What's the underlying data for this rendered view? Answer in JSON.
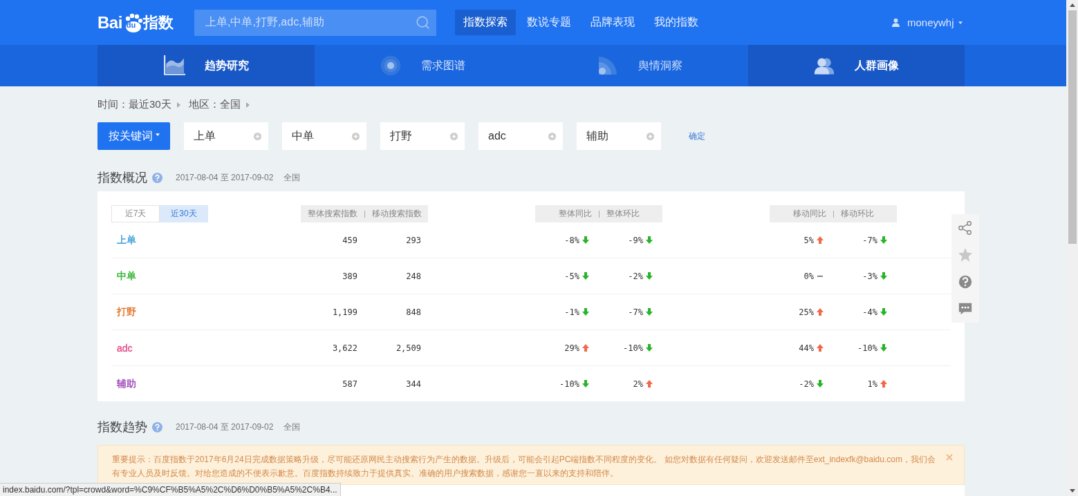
{
  "header": {
    "logo": {
      "left": "Bai",
      "paw": "du",
      "right": "指数"
    },
    "search": {
      "value": "上单,中单,打野,adc,辅助"
    },
    "nav": [
      {
        "label": "指数探索",
        "selected": true
      },
      {
        "label": "数说专题",
        "selected": false
      },
      {
        "label": "品牌表现",
        "selected": false
      },
      {
        "label": "我的指数",
        "selected": false
      }
    ],
    "user": {
      "name": "moneywhj"
    }
  },
  "subnav": [
    {
      "label": "趋势研究",
      "selected": true,
      "kind": "area"
    },
    {
      "label": "需求图谱",
      "selected": false,
      "kind": "ring"
    },
    {
      "label": "舆情洞察",
      "selected": false,
      "kind": "wave"
    },
    {
      "label": "人群画像",
      "selected": true,
      "kind": "people"
    }
  ],
  "filters": [
    "时间：最近30天",
    "地区：全国"
  ],
  "keywords": {
    "mode": "按关键词",
    "items": [
      "上单",
      "中单",
      "打野",
      "adc",
      "辅助"
    ],
    "confirm": "确定"
  },
  "overview": {
    "title": "指数概况",
    "dates": "2017-08-04 至 2017-09-02",
    "region": "全国",
    "ranges": [
      {
        "label": "近7天",
        "selected": false
      },
      {
        "label": "近30天",
        "selected": true
      }
    ],
    "groups": [
      [
        "整体搜索指数",
        "移动搜索指数"
      ],
      [
        "整体同比",
        "整体环比"
      ],
      [
        "移动同比",
        "移动环比"
      ]
    ],
    "rows": [
      {
        "keyword": "上单",
        "color": "#3a9fd8",
        "total": "459",
        "mobile": "293",
        "changes": [
          {
            "value": "-8%",
            "kind": "down"
          },
          {
            "value": "-9%",
            "kind": "down"
          },
          {
            "value": "5%",
            "kind": "up"
          },
          {
            "value": "-7%",
            "kind": "down"
          }
        ]
      },
      {
        "keyword": "中单",
        "color": "#2fb02f",
        "total": "389",
        "mobile": "248",
        "changes": [
          {
            "value": "-5%",
            "kind": "down"
          },
          {
            "value": "-2%",
            "kind": "down"
          },
          {
            "value": "0%",
            "kind": "flat"
          },
          {
            "value": "-3%",
            "kind": "down"
          }
        ]
      },
      {
        "keyword": "打野",
        "color": "#e07020",
        "total": "1,199",
        "mobile": "848",
        "changes": [
          {
            "value": "-1%",
            "kind": "down"
          },
          {
            "value": "-7%",
            "kind": "down"
          },
          {
            "value": "25%",
            "kind": "up"
          },
          {
            "value": "-4%",
            "kind": "down"
          }
        ]
      },
      {
        "keyword": "adc",
        "color": "#e64d8c",
        "total": "3,622",
        "mobile": "2,509",
        "changes": [
          {
            "value": "29%",
            "kind": "up"
          },
          {
            "value": "-10%",
            "kind": "down"
          },
          {
            "value": "44%",
            "kind": "up"
          },
          {
            "value": "-10%",
            "kind": "down"
          }
        ]
      },
      {
        "keyword": "辅助",
        "color": "#9a3fb5",
        "total": "587",
        "mobile": "344",
        "changes": [
          {
            "value": "-10%",
            "kind": "down"
          },
          {
            "value": "2%",
            "kind": "up"
          },
          {
            "value": "-2%",
            "kind": "down"
          },
          {
            "value": "1%",
            "kind": "up"
          }
        ]
      }
    ]
  },
  "trend": {
    "title": "指数趋势",
    "dates": "2017-08-04 至 2017-09-02",
    "region": "全国",
    "notice": "重要提示：百度指数于2017年6月24日完成数据策略升级，尽可能还原网民主动搜索行为产生的数据。升级后，可能会引起PC端指数不同程度的变化。 如您对数据有任何疑问，欢迎发送邮件至ext_indexfk@baidu.com，我们会有专业人员及时反馈。对给您造成的不便表示歉意。百度指数持续致力于提供真实、准确的用户搜索数据，感谢您一直以来的支持和陪伴。"
  },
  "status_bar": "index.baidu.com/?tpl=crowd&word=%C9%CF%B5%A5%2C%D6%D0%B5%A5%2C%B4..."
}
